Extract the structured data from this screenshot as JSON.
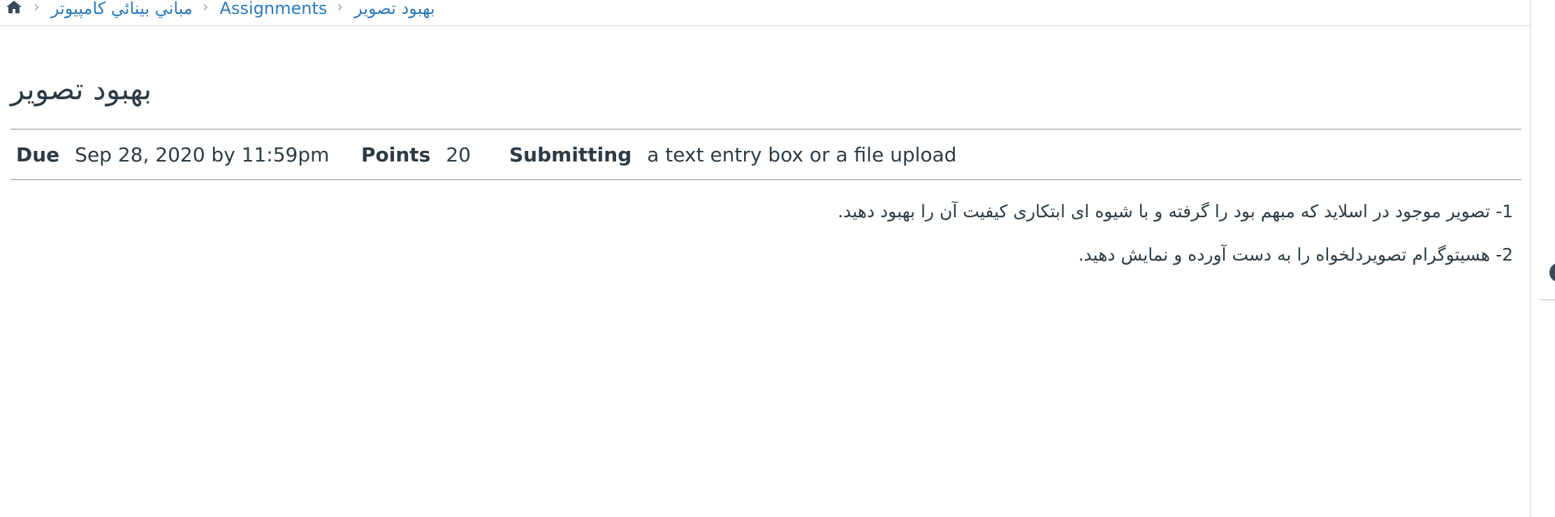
{
  "breadcrumb": {
    "home_icon": "home-icon",
    "course": "مباني بينائي كامپيوتر",
    "assignments": "Assignments",
    "current": "بهبود تصوير"
  },
  "assignment": {
    "title": "بهبود تصوير",
    "due_label": "Due",
    "due_value": "Sep 28, 2020 by 11:59pm",
    "points_label": "Points",
    "points_value": "20",
    "submitting_label": "Submitting",
    "submitting_value": "a text entry box or a file upload"
  },
  "description": {
    "lines": [
      "1- تصویر موجود در اسلاید که مبهم بود را گرفته و با شیوه ای ابتکاری کیفیت آن را بهبود دهید.",
      "2- هسیتوگرام تصویردلخواه را به دست آورده و نمایش دهید."
    ]
  },
  "colors": {
    "link": "#2b7abc",
    "text": "#2d3b45",
    "separator": "#a0a8ae"
  }
}
